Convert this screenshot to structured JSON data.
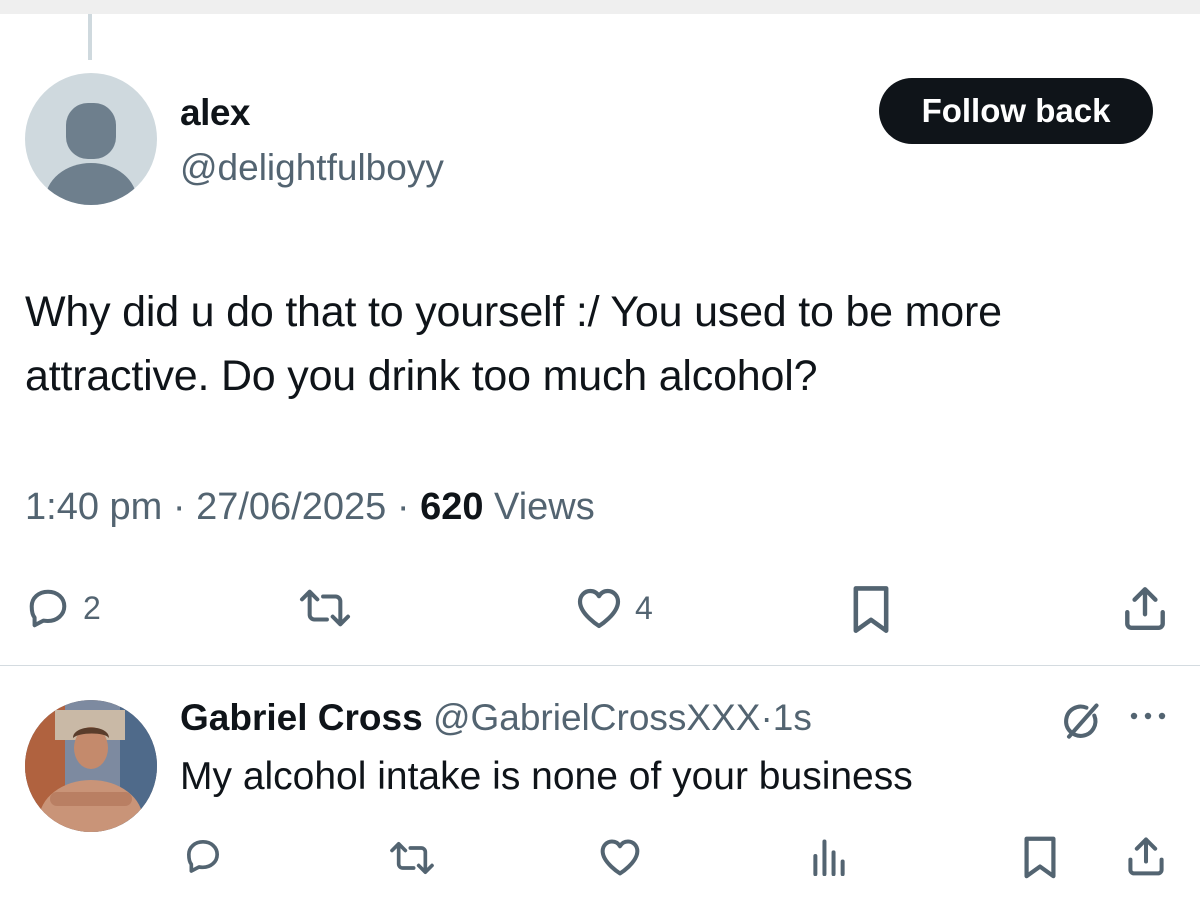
{
  "main_tweet": {
    "author": {
      "display_name": "alex",
      "handle": "@delightfulboyy"
    },
    "follow_button_label": "Follow back",
    "text": "Why did u do that to yourself :/ You used to be more attractive. Do you drink too much alcohol?",
    "time": "1:40 pm",
    "separator": "·",
    "date": "27/06/2025",
    "views_count": "620",
    "views_label": "Views",
    "actions": {
      "reply_count": "2",
      "retweet_count": "",
      "like_count": "4"
    }
  },
  "reply": {
    "author": {
      "display_name": "Gabriel Cross",
      "handle": "@GabrielCrossXXX",
      "separator": "·",
      "time": "1s"
    },
    "text": "My alcohol intake is none of your business"
  },
  "icons": {
    "reply": "reply-icon",
    "retweet": "retweet-icon",
    "like": "heart-icon",
    "bookmark": "bookmark-icon",
    "share": "share-icon",
    "views": "analytics-icon",
    "grok": "grok-icon",
    "more": "more-icon"
  },
  "colors": {
    "text_primary": "#0f1419",
    "text_secondary": "#536471",
    "button_dark": "#0f1419",
    "default_avatar_bg": "#cfd9de",
    "default_avatar_fg": "#6e7f8d"
  }
}
